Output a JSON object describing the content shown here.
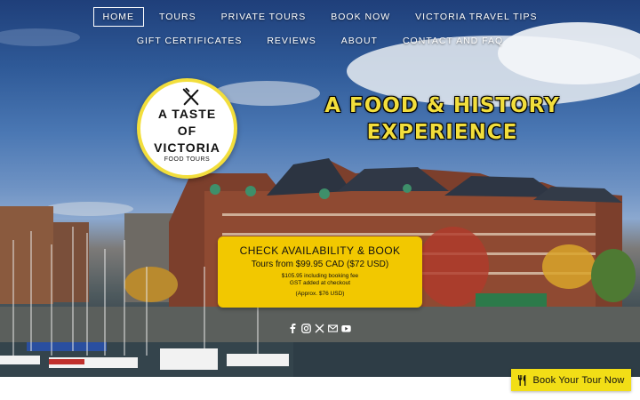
{
  "nav": {
    "row1": [
      "HOME",
      "TOURS",
      "PRIVATE TOURS",
      "BOOK NOW",
      "VICTORIA TRAVEL TIPS"
    ],
    "row2": [
      "GIFT CERTIFICATES",
      "REVIEWS",
      "ABOUT",
      "CONTACT AND FAQ"
    ],
    "active": "HOME"
  },
  "logo": {
    "line1": "A TASTE",
    "line2": "OF",
    "line3": "VICTORIA",
    "line4": "FOOD TOURS"
  },
  "headline": {
    "line1": "A FOOD & HISTORY",
    "line2": "EXPERIENCE"
  },
  "booking": {
    "title": "CHECK AVAILABILITY & BOOK",
    "price": "Tours from $99.95 CAD ($72 USD)",
    "fee": "$105.95 including booking fee",
    "gst": "GST added at checkout",
    "approx": "(Approx. $76 USD)"
  },
  "social": [
    "facebook-icon",
    "instagram-icon",
    "x-icon",
    "email-icon",
    "youtube-icon"
  ],
  "tour_button": {
    "label": "Book Your Tour Now"
  },
  "colors": {
    "accent_yellow": "#f2c800",
    "button_yellow": "#f2de16",
    "logo_ring": "#f2de3c"
  }
}
